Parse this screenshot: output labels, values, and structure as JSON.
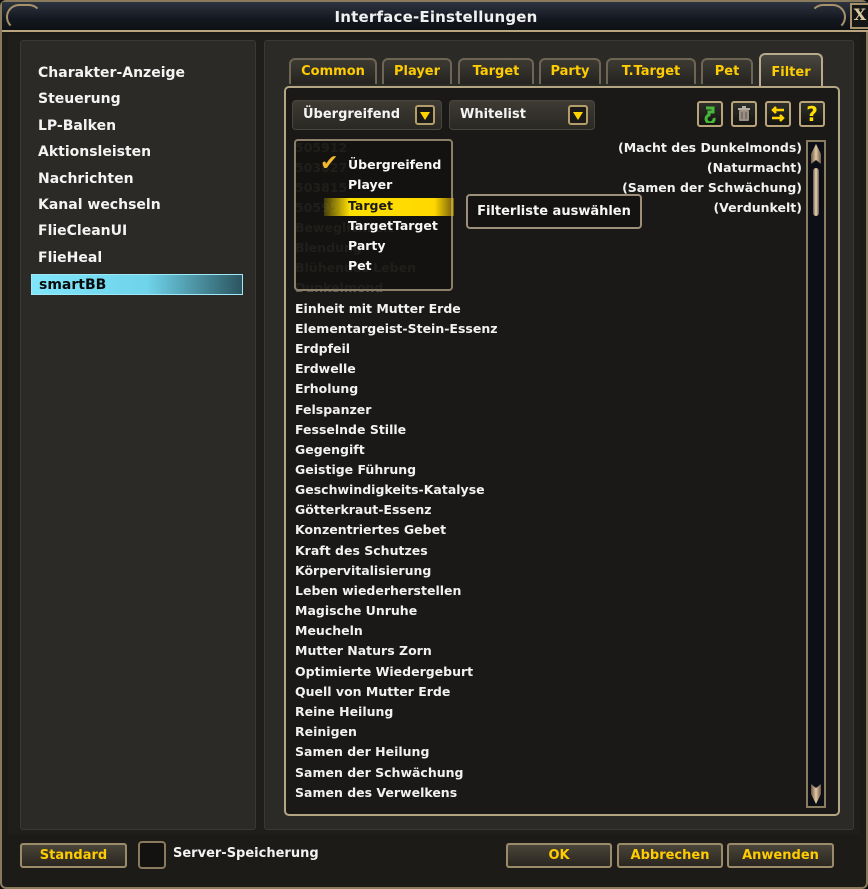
{
  "window": {
    "title": "Interface-Einstellungen",
    "close_label": "X"
  },
  "sidebar": {
    "items": [
      {
        "label": "Charakter-Anzeige"
      },
      {
        "label": "Steuerung"
      },
      {
        "label": "LP-Balken"
      },
      {
        "label": "Aktionsleisten"
      },
      {
        "label": "Nachrichten"
      },
      {
        "label": "Kanal wechseln"
      },
      {
        "label": "FlieCleanUI"
      },
      {
        "label": "FlieHeal"
      },
      {
        "label": "smartBB",
        "selected": true
      }
    ]
  },
  "tabs": [
    {
      "label": "Common"
    },
    {
      "label": "Player"
    },
    {
      "label": "Target"
    },
    {
      "label": "Party"
    },
    {
      "label": "T.Target"
    },
    {
      "label": "Pet"
    },
    {
      "label": "Filter",
      "active": true
    }
  ],
  "filter": {
    "scope_select": {
      "value": "Übergreifend"
    },
    "mode_select": {
      "value": "Whitelist"
    },
    "toolbar": {
      "reset_icon": "undo-arrow-icon",
      "delete_icon": "trash-icon",
      "swap_icon": "swap-arrows-icon",
      "help_label": "?"
    },
    "dropdown": {
      "options": [
        {
          "label": "Übergreifend",
          "checked": true
        },
        {
          "label": "Player"
        },
        {
          "label": "Target",
          "hovered": true
        },
        {
          "label": "TargetTarget"
        },
        {
          "label": "Party"
        },
        {
          "label": "Pet"
        }
      ],
      "check_glyph": "✔"
    },
    "tooltip": "Filterliste auswählen",
    "hidden_items": [
      "505912",
      "503827",
      "503815",
      "505956",
      "Beweglichkeit",
      "Blendung",
      "Blühendes Leben",
      "Dunkelmond"
    ],
    "list_items": [
      "Einheit mit Mutter Erde",
      "Elementargeist-Stein-Essenz",
      "Erdpfeil",
      "Erdwelle",
      "Erholung",
      "Felspanzer",
      "Fesselnde Stille",
      "Gegengift",
      "Geistige Führung",
      "Geschwindigkeits-Katalyse",
      "Götterkraut-Essenz",
      "Konzentriertes Gebet",
      "Kraft des Schutzes",
      "Körpervitalisierung",
      "Leben wiederherstellen",
      "Magische Unruhe",
      "Meucheln",
      "Mutter Naturs Zorn",
      "Optimierte Wiedergeburt",
      "Quell von Mutter Erde",
      "Reine Heilung",
      "Reinigen",
      "Samen der Heilung",
      "Samen der Schwächung",
      "Samen des Verwelkens"
    ],
    "right_items": [
      "(Macht des Dunkelmonds)",
      "(Naturmacht)",
      "(Samen der Schwächung)",
      "(Verdunkelt)"
    ]
  },
  "footer": {
    "standard_label": "Standard",
    "server_save_label": "Server-Speicherung",
    "server_save_checked": false,
    "ok_label": "OK",
    "cancel_label": "Abbrechen",
    "apply_label": "Anwenden"
  }
}
